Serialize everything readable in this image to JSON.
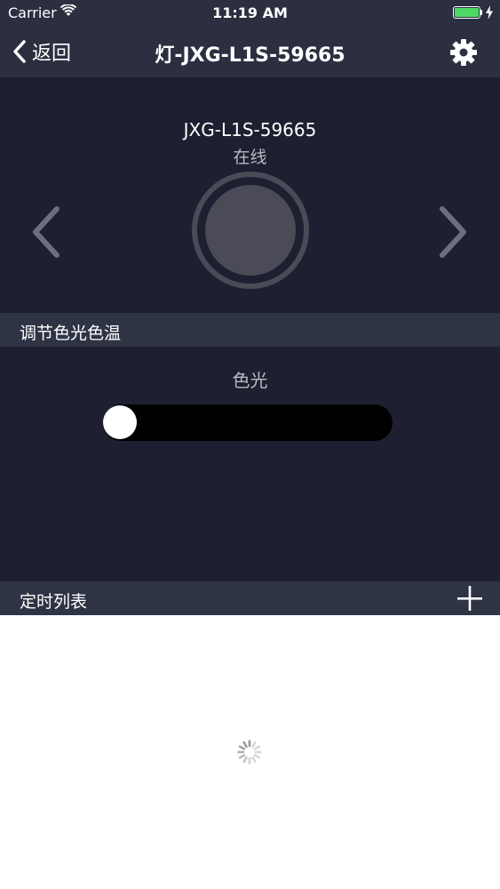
{
  "status_bar": {
    "carrier": "Carrier",
    "time": "11:19 AM",
    "battery_level": 1.0,
    "battery_color": "#4cd964",
    "icons": [
      "wifi-icon",
      "battery-icon",
      "charging-bolt-icon"
    ]
  },
  "nav": {
    "back_label": "返回",
    "title": "灯-JXG-L1S-59665",
    "icons": [
      "chevron-left-icon",
      "gear-icon"
    ]
  },
  "device": {
    "name": "JXG-L1S-59665",
    "status": "在线",
    "icons": [
      "chevron-left-icon",
      "chevron-right-icon",
      "power-circle-icon"
    ]
  },
  "color_section": {
    "header": "调节色光色温",
    "control_label": "色光",
    "slider_value": 0
  },
  "timer_section": {
    "header": "定时列表",
    "icons": [
      "plus-icon",
      "loading-spinner-icon"
    ]
  },
  "colors": {
    "bar_background": "#2b2f40",
    "panel_background": "#1e1f30",
    "section_header": "#2f3445",
    "accent_green": "#4cd964"
  }
}
